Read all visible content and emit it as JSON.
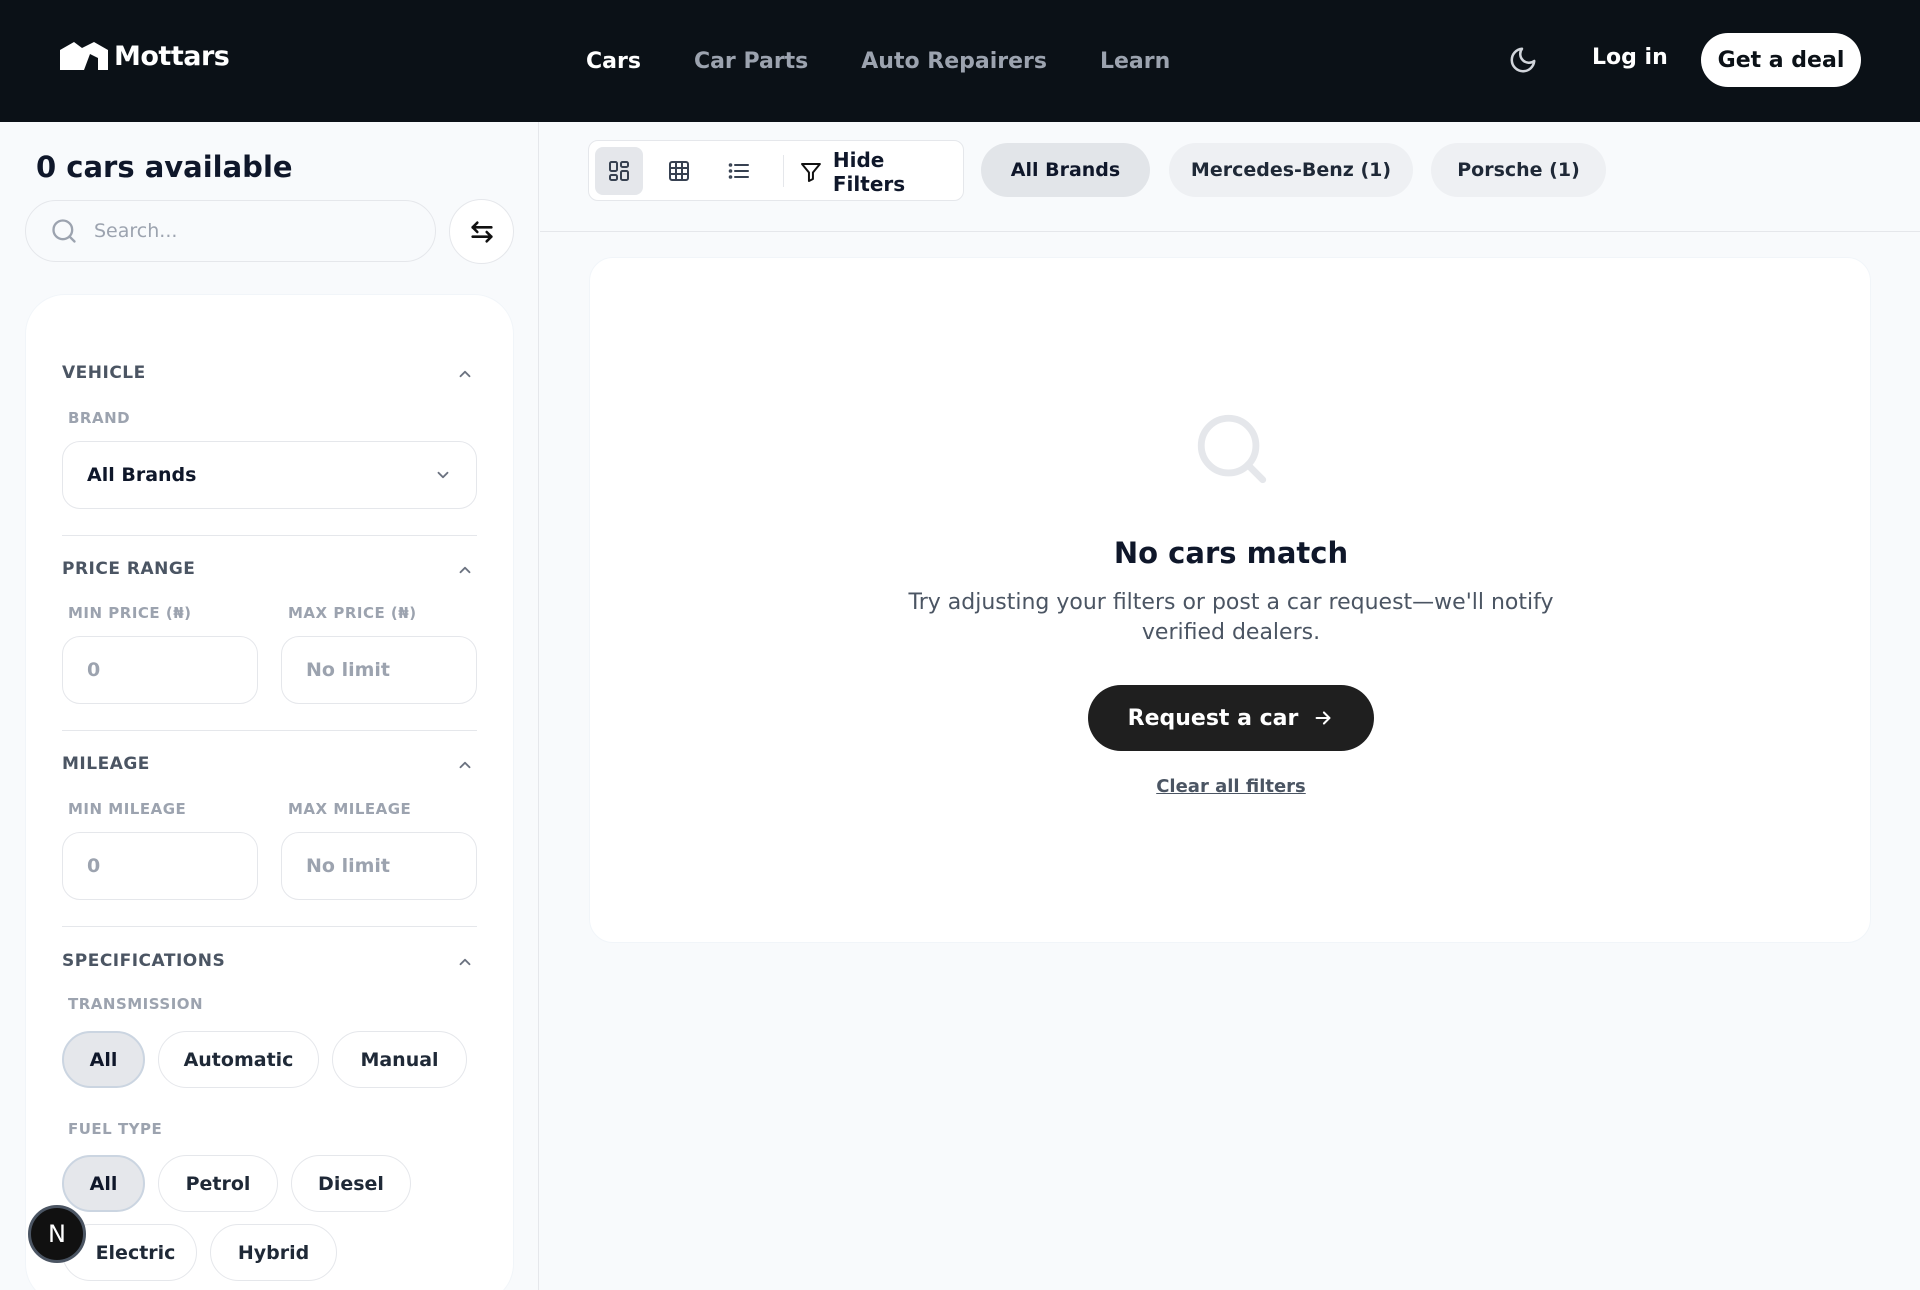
{
  "header": {
    "logo_text": "Mottars",
    "nav": [
      {
        "label": "Cars"
      },
      {
        "label": "Car Parts"
      },
      {
        "label": "Auto Repairers"
      },
      {
        "label": "Learn"
      }
    ],
    "login_label": "Log in",
    "cta_label": "Get a deal"
  },
  "sidebar": {
    "count_title": "0 cars available",
    "search_placeholder": "Search...",
    "vehicle": {
      "heading": "VEHICLE",
      "brand_label": "BRAND",
      "brand_value": "All Brands"
    },
    "price": {
      "heading": "PRICE RANGE",
      "min_label": "MIN PRICE (₦)",
      "max_label": "MAX PRICE (₦)",
      "min_placeholder": "0",
      "max_placeholder": "No limit"
    },
    "mileage": {
      "heading": "MILEAGE",
      "min_label": "MIN MILEAGE",
      "max_label": "MAX MILEAGE",
      "min_placeholder": "0",
      "max_placeholder": "No limit"
    },
    "specs": {
      "heading": "SPECIFICATIONS",
      "transmission_label": "TRANSMISSION",
      "transmission_options": [
        "All",
        "Automatic",
        "Manual"
      ],
      "transmission_selected": "All",
      "fuel_label": "FUEL TYPE",
      "fuel_options": [
        "All",
        "Petrol",
        "Diesel",
        "Electric",
        "Hybrid"
      ],
      "fuel_selected": "All"
    },
    "badge_letter": "N"
  },
  "toolbar": {
    "hide_filters_label": "Hide Filters",
    "brand_pills": [
      "All Brands",
      "Mercedes-Benz (1)",
      "Porsche (1)"
    ],
    "active_view": "grid-cards"
  },
  "empty_state": {
    "title": "No cars match",
    "subtitle": "Try adjusting your filters or post a car request—we'll notify verified dealers.",
    "button_label": "Request a car",
    "clear_label": "Clear all filters"
  },
  "colors": {
    "topbar_bg": "#0b1117",
    "page_bg": "#f8fafc",
    "primary_button": "#1f1f1f"
  }
}
